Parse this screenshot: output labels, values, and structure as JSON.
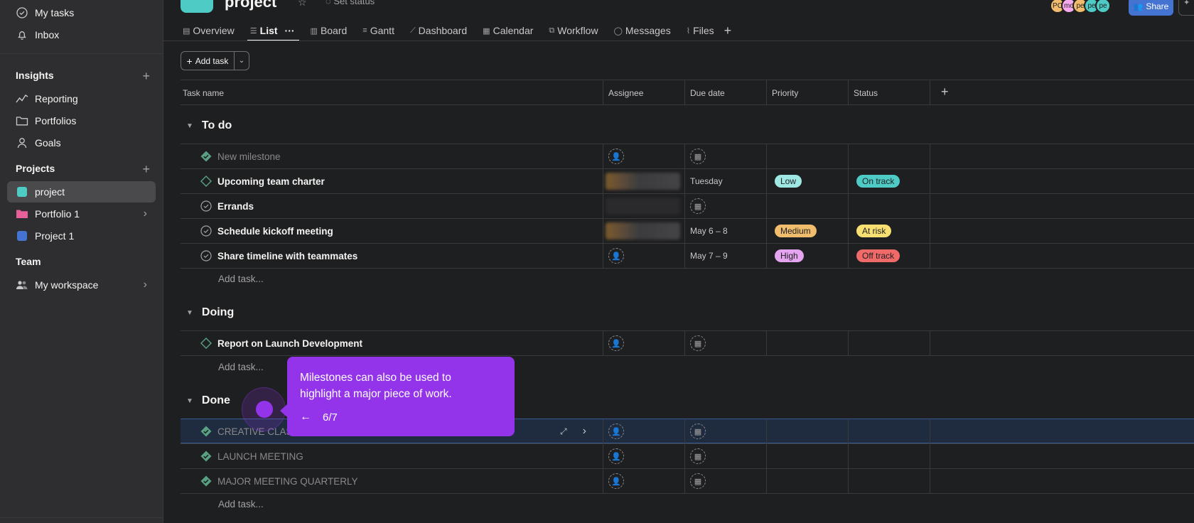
{
  "colors": {
    "bg": "#1e1f21",
    "sidebar": "#2e2e30",
    "accent": "#9333ea",
    "share": "#4573d2",
    "project_teal": "#4ecbc4",
    "portfolio_pink": "#e8609a",
    "project1_blue": "#4573d2",
    "milestone_green": "#58a182"
  },
  "sidebar": {
    "top_items": [
      {
        "label": "My tasks",
        "icon": "check-circle-icon"
      },
      {
        "label": "Inbox",
        "icon": "bell-icon"
      }
    ],
    "insights": {
      "heading": "Insights",
      "items": [
        {
          "label": "Reporting",
          "icon": "chart-line-icon"
        },
        {
          "label": "Portfolios",
          "icon": "folder-icon"
        },
        {
          "label": "Goals",
          "icon": "person-icon"
        }
      ]
    },
    "projects": {
      "heading": "Projects",
      "items": [
        {
          "label": "project"
        },
        {
          "label": "Portfolio 1"
        },
        {
          "label": "Project 1"
        }
      ]
    },
    "team": {
      "heading": "Team",
      "items": [
        {
          "label": "My workspace",
          "icon": "people-icon"
        }
      ]
    }
  },
  "header": {
    "title": "project",
    "status": "Set status",
    "share_label": "Share",
    "avatars": [
      "PC",
      "mo",
      "pe",
      "pe",
      "pe"
    ],
    "tabs": [
      {
        "label": "Overview",
        "icon": "document-icon"
      },
      {
        "label": "List",
        "icon": "list-icon"
      },
      {
        "label": "Board",
        "icon": "board-icon"
      },
      {
        "label": "Gantt",
        "icon": "gantt-icon"
      },
      {
        "label": "Dashboard",
        "icon": "chart-icon"
      },
      {
        "label": "Calendar",
        "icon": "calendar-icon"
      },
      {
        "label": "Workflow",
        "icon": "workflow-icon"
      },
      {
        "label": "Messages",
        "icon": "message-icon"
      },
      {
        "label": "Files",
        "icon": "paperclip-icon"
      }
    ]
  },
  "toolbar": {
    "add_task": "Add task"
  },
  "table": {
    "columns": [
      "Task name",
      "Assignee",
      "Due date",
      "Priority",
      "Status"
    ],
    "add_task_placeholder": "Add task...",
    "sections": [
      {
        "name": "To do",
        "rows": [
          {
            "name": "New milestone",
            "type": "milestone-done",
            "due": "",
            "priority": "",
            "status": ""
          },
          {
            "name": "Upcoming team charter",
            "type": "milestone",
            "due": "Tuesday",
            "priority": "Low",
            "status": "On track"
          },
          {
            "name": "Errands",
            "type": "task",
            "due": "",
            "priority": "",
            "status": ""
          },
          {
            "name": "Schedule kickoff meeting",
            "type": "task",
            "due": "May 6 – 8",
            "priority": "Medium",
            "status": "At risk"
          },
          {
            "name": "Share timeline with teammates",
            "type": "task",
            "due": "May 7 – 9",
            "priority": "High",
            "status": "Off track"
          }
        ]
      },
      {
        "name": "Doing",
        "rows": [
          {
            "name": "Report on Launch Development",
            "type": "milestone",
            "due": "",
            "priority": "",
            "status": ""
          }
        ]
      },
      {
        "name": "Done",
        "rows": [
          {
            "name": "CREATIVE CLASS",
            "type": "milestone-done",
            "due": "",
            "priority": "",
            "status": ""
          },
          {
            "name": "LAUNCH MEETING",
            "type": "milestone-done",
            "due": "",
            "priority": "",
            "status": ""
          },
          {
            "name": "MAJOR MEETING QUARTERLY",
            "type": "milestone-done",
            "due": "",
            "priority": "",
            "status": ""
          }
        ]
      }
    ]
  },
  "tooltip": {
    "text": "Milestones can also be used to highlight a major piece of work.",
    "step": "6/7"
  }
}
